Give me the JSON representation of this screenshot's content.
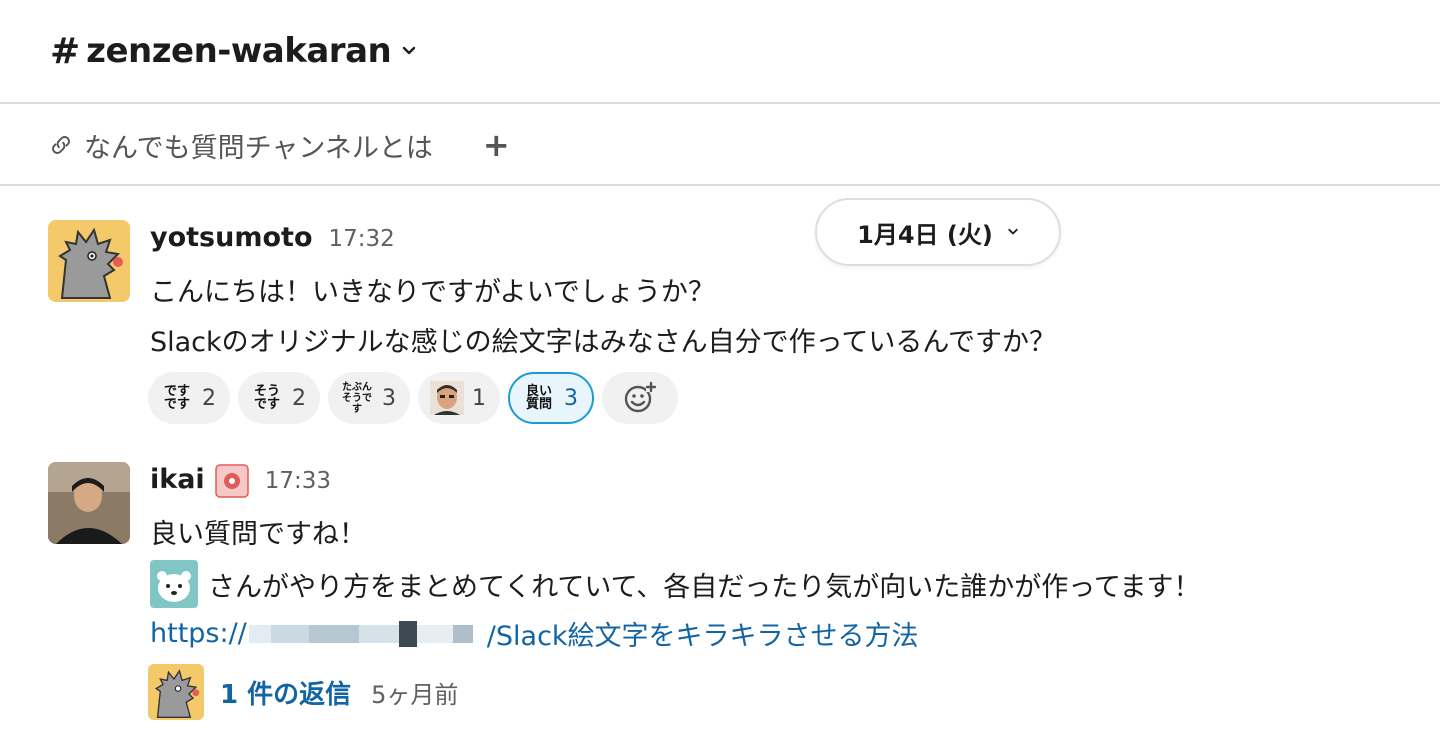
{
  "channel": {
    "hash": "#",
    "name": "zenzen-wakaran"
  },
  "bookmark": {
    "label": "なんでも質問チャンネルとは",
    "add": "+"
  },
  "date_divider": "1月4日 (火)",
  "messages": [
    {
      "user": "yotsumoto",
      "time": "17:32",
      "lines": [
        "こんにちは！いきなりですがよいでしょうか？",
        "Slackのオリジナルな感じの絵文字はみなさん自分で作っているんですか？"
      ],
      "reactions": [
        {
          "emoji": "ですです",
          "count": "2",
          "active": false
        },
        {
          "emoji": "そうです",
          "count": "2",
          "active": false
        },
        {
          "emoji": "たぶんそうです",
          "count": "3",
          "active": false
        },
        {
          "emoji": "face-avatar",
          "count": "1",
          "active": false
        },
        {
          "emoji": "良い質問",
          "count": "3",
          "active": true
        }
      ]
    },
    {
      "user": "ikai",
      "time": "17:33",
      "lines": [
        "良い質問ですね！",
        "さんがやり方をまとめてくれていて、各自だったり気が向いた誰かが作ってます！"
      ],
      "link_prefix": "https://",
      "link_suffix": "/Slack絵文字をキラキラさせる方法",
      "thread": {
        "replies": "1 件の返信",
        "time": "5ヶ月前"
      }
    }
  ],
  "colors": {
    "link": "#1264a3",
    "active_reaction_border": "#1d9bd1"
  }
}
